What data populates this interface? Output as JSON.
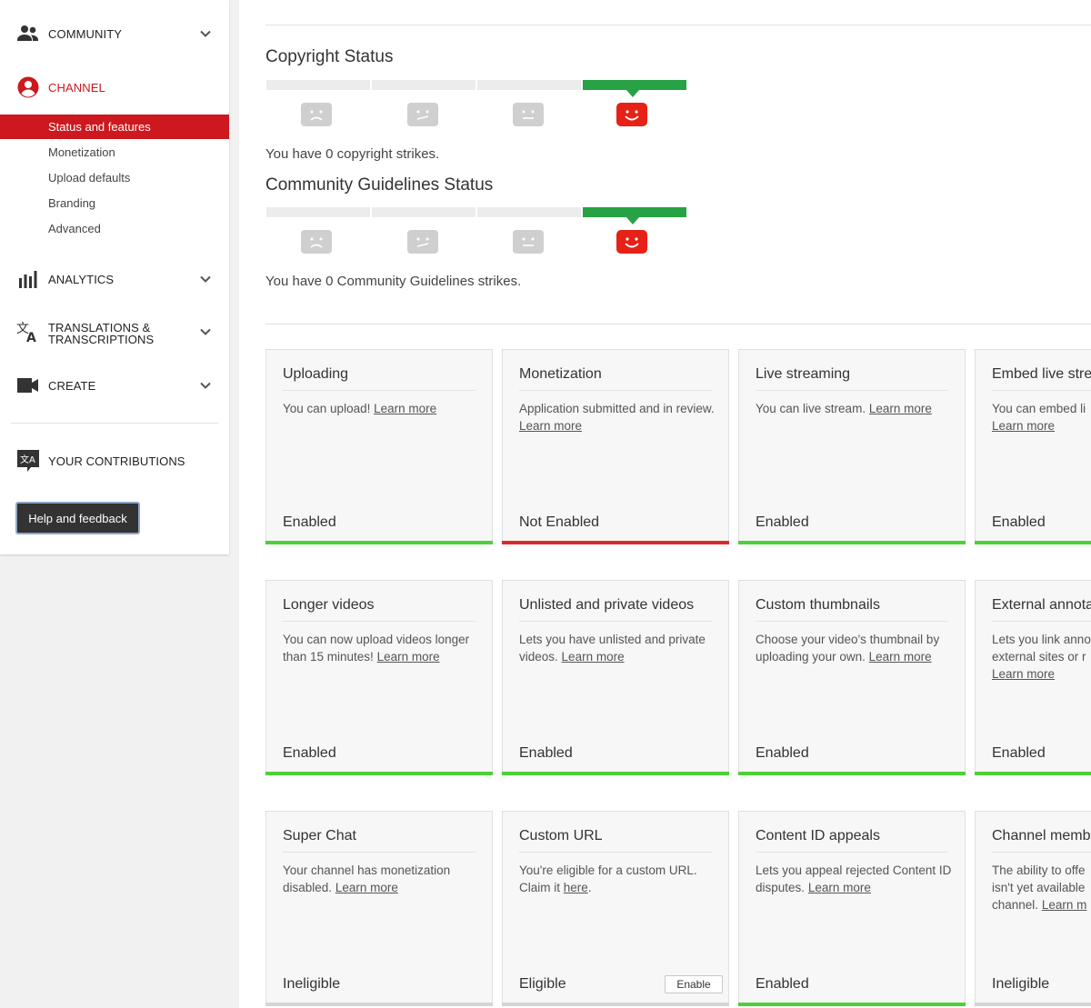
{
  "sidebar": {
    "community": "COMMUNITY",
    "channel": "CHANNEL",
    "channel_items": [
      "Status and features",
      "Monetization",
      "Upload defaults",
      "Branding",
      "Advanced"
    ],
    "analytics": "ANALYTICS",
    "translations_line1": "TRANSLATIONS &",
    "translations_line2": "TRANSCRIPTIONS",
    "create": "CREATE",
    "contributions": "YOUR CONTRIBUTIONS",
    "help_button": "Help and feedback"
  },
  "copyright": {
    "title": "Copyright Status",
    "text": "You have 0 copyright strikes."
  },
  "guidelines": {
    "title": "Community Guidelines Status",
    "text": "You have 0 Community Guidelines strikes."
  },
  "learn_more": "Learn more",
  "cards": [
    {
      "title": "Uploading",
      "desc": "You can upload!",
      "link": "Learn more",
      "status": "Enabled"
    },
    {
      "title": "Monetization",
      "desc": "Application submitted and in review.",
      "link": "Learn more",
      "status": "Not Enabled"
    },
    {
      "title": "Live streaming",
      "desc": "You can live stream.",
      "link": "Learn more",
      "status": "Enabled"
    },
    {
      "title": "Embed live stre",
      "desc": "You can embed li",
      "link": "Learn more",
      "status": "Enabled"
    },
    {
      "title": "Longer videos",
      "desc": "You can now upload videos longer than 15 minutes!",
      "link": "Learn more",
      "status": "Enabled"
    },
    {
      "title": "Unlisted and private videos",
      "desc": "Lets you have unlisted and private videos.",
      "link": "Learn more",
      "status": "Enabled"
    },
    {
      "title": "Custom thumbnails",
      "desc": "Choose your video's thumbnail by uploading your own.",
      "link": "Learn more",
      "status": "Enabled"
    },
    {
      "title": "External annota",
      "desc": "Lets you link anno external sites or r",
      "link": "Learn more",
      "status": "Enabled"
    },
    {
      "title": "Super Chat",
      "desc": "Your channel has monetization disabled.",
      "link": "Learn more",
      "status": "Ineligible"
    },
    {
      "title": "Custom URL",
      "desc": "You're eligible for a custom URL. Claim it",
      "link": "here",
      "desc_after": ".",
      "status": "Eligible",
      "button": "Enable"
    },
    {
      "title": "Content ID appeals",
      "desc": "Lets you appeal rejected Content ID disputes.",
      "link": "Learn more",
      "status": "Enabled"
    },
    {
      "title": "Channel memb",
      "desc": "The ability to offe isn't yet available channel.",
      "link": "Learn m",
      "status": "Ineligible"
    }
  ],
  "colors": {
    "brand_red": "#cc181e",
    "meter_green": "#27a244",
    "enabled_bar": "#4cd137",
    "not_enabled_bar": "#d92b2b",
    "ineligible_bar": "#d4d4d4"
  }
}
